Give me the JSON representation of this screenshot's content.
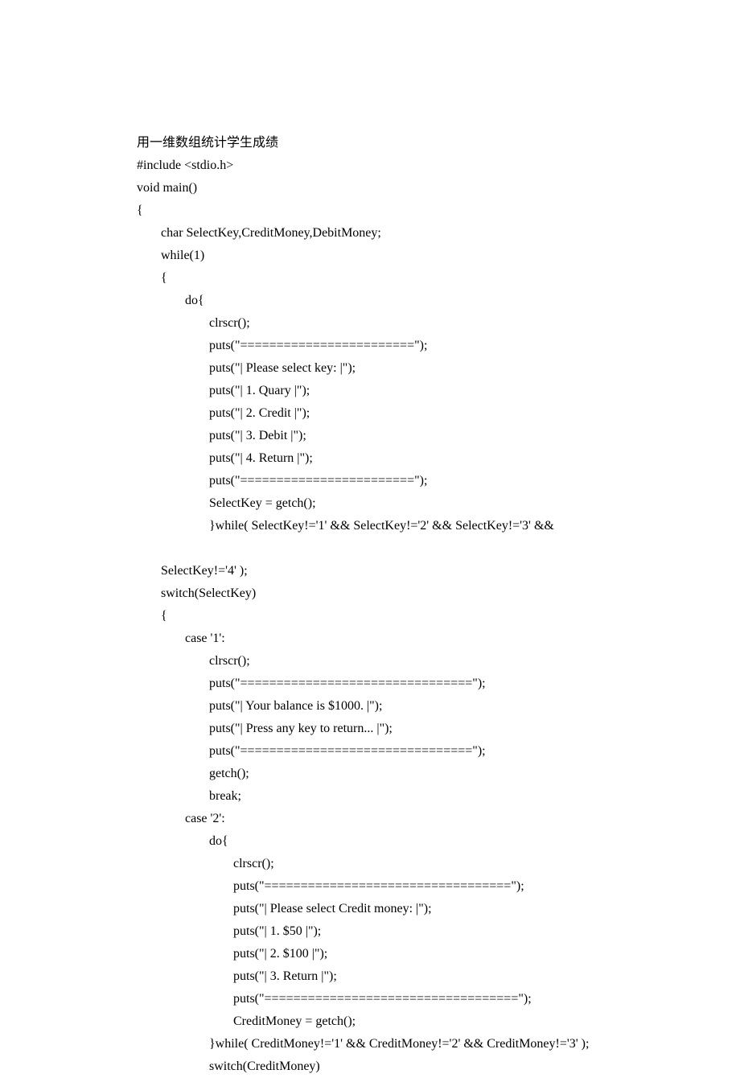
{
  "lines": [
    {
      "text": "用一维数组统计学生成绩",
      "indent": 0,
      "cjk": true
    },
    {
      "text": "#include <stdio.h>",
      "indent": 0
    },
    {
      "text": "void main()",
      "indent": 0
    },
    {
      "text": "{",
      "indent": 0
    },
    {
      "text": "char SelectKey,CreditMoney,DebitMoney;",
      "indent": 1
    },
    {
      "text": "while(1)",
      "indent": 1
    },
    {
      "text": "{",
      "indent": 1
    },
    {
      "text": "do{",
      "indent": 2
    },
    {
      "text": "clrscr();",
      "indent": 3
    },
    {
      "text": "puts(\"========================\");",
      "indent": 3
    },
    {
      "text": "puts(\"| Please select key: |\");",
      "indent": 3
    },
    {
      "text": "puts(\"| 1. Quary |\");",
      "indent": 3
    },
    {
      "text": "puts(\"| 2. Credit |\");",
      "indent": 3
    },
    {
      "text": "puts(\"| 3. Debit |\");",
      "indent": 3
    },
    {
      "text": "puts(\"| 4. Return |\");",
      "indent": 3
    },
    {
      "text": "puts(\"========================\");",
      "indent": 3
    },
    {
      "text": "SelectKey = getch();",
      "indent": 3
    },
    {
      "text": "}while( SelectKey!='1' && SelectKey!='2' && SelectKey!='3' &&",
      "indent": 3
    },
    {
      "text": " ",
      "indent": 0
    },
    {
      "text": "SelectKey!='4' );",
      "indent": 1
    },
    {
      "text": "switch(SelectKey)",
      "indent": 1
    },
    {
      "text": "{",
      "indent": 1
    },
    {
      "text": "case '1':",
      "indent": 2
    },
    {
      "text": "clrscr();",
      "indent": 3
    },
    {
      "text": "puts(\"================================\");",
      "indent": 3
    },
    {
      "text": "puts(\"| Your balance is $1000. |\");",
      "indent": 3
    },
    {
      "text": "puts(\"| Press any key to return... |\");",
      "indent": 3
    },
    {
      "text": "puts(\"================================\");",
      "indent": 3
    },
    {
      "text": "getch();",
      "indent": 3
    },
    {
      "text": "break;",
      "indent": 3
    },
    {
      "text": "case '2':",
      "indent": 2
    },
    {
      "text": "do{",
      "indent": 3
    },
    {
      "text": "clrscr();",
      "indent": 4
    },
    {
      "text": "puts(\"==================================\");",
      "indent": 4
    },
    {
      "text": "puts(\"| Please select Credit money: |\");",
      "indent": 4
    },
    {
      "text": "puts(\"| 1. $50 |\");",
      "indent": 4
    },
    {
      "text": "puts(\"| 2. $100 |\");",
      "indent": 4
    },
    {
      "text": "puts(\"| 3. Return |\");",
      "indent": 4
    },
    {
      "text": "puts(\"===================================\");",
      "indent": 4
    },
    {
      "text": "CreditMoney = getch();",
      "indent": 4
    },
    {
      "text": "}while( CreditMoney!='1' && CreditMoney!='2' && CreditMoney!='3' );",
      "indent": 3
    },
    {
      "text": "switch(CreditMoney)",
      "indent": 3
    }
  ]
}
